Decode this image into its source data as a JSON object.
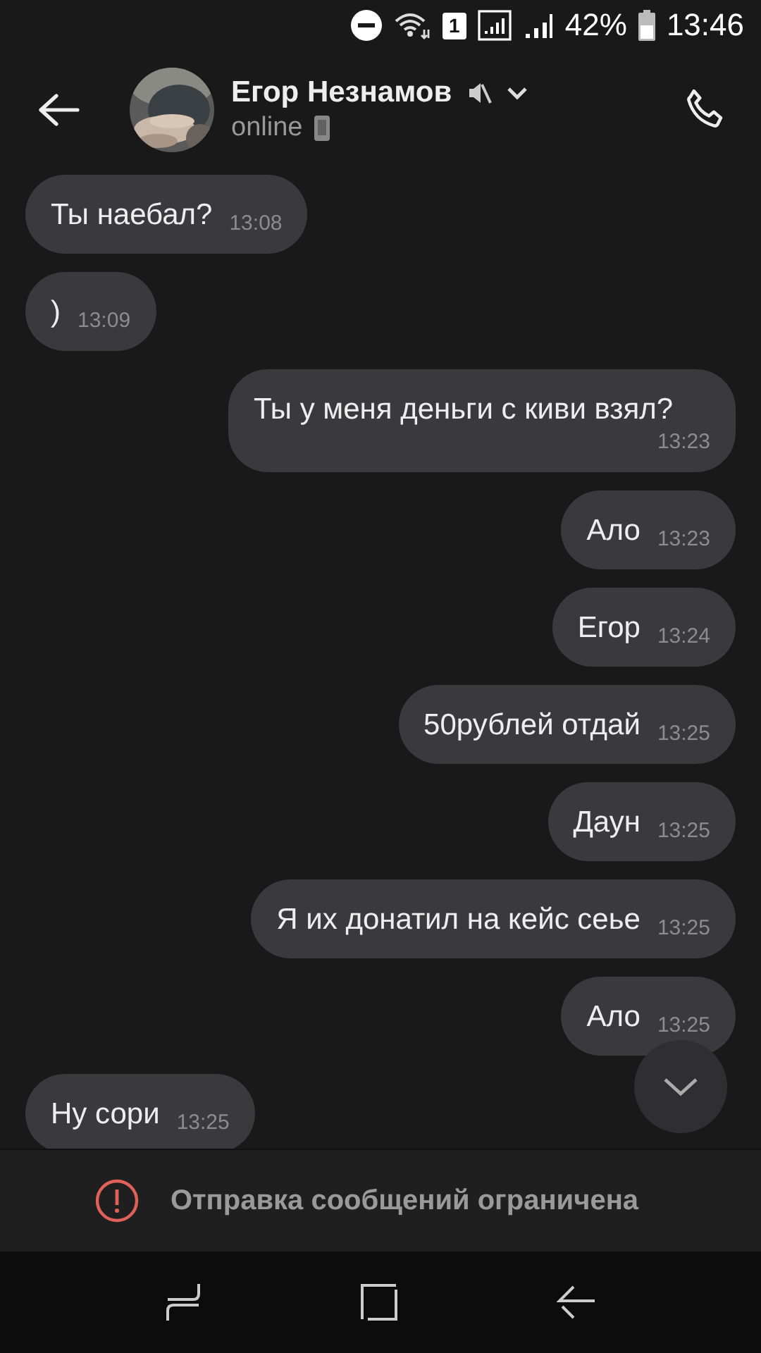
{
  "status_bar": {
    "sim": "1",
    "battery": "42%",
    "time": "13:46"
  },
  "header": {
    "name": "Егор Незнамов",
    "status": "online",
    "muted": true
  },
  "messages": [
    {
      "kind": "incoming",
      "text": "Ты наебал?",
      "time": "13:08"
    },
    {
      "kind": "incoming",
      "text": ")",
      "time": "13:09"
    },
    {
      "kind": "outgoing",
      "text": "Ты у меня деньги с киви взял?",
      "time": "13:23"
    },
    {
      "kind": "outgoing",
      "text": "Ало",
      "time": "13:23"
    },
    {
      "kind": "outgoing",
      "text": "Егор",
      "time": "13:24"
    },
    {
      "kind": "outgoing",
      "text": "50рублей отдай",
      "time": "13:25"
    },
    {
      "kind": "outgoing",
      "text": "Даун",
      "time": "13:25"
    },
    {
      "kind": "outgoing",
      "text": "Я их донатил на кейс сеье",
      "time": "13:25"
    },
    {
      "kind": "outgoing",
      "text": "Ало",
      "time": "13:25"
    },
    {
      "kind": "incoming",
      "text": "Ну сори",
      "time": "13:25"
    }
  ],
  "banner": {
    "text": "Отправка сообщений ограничена"
  }
}
